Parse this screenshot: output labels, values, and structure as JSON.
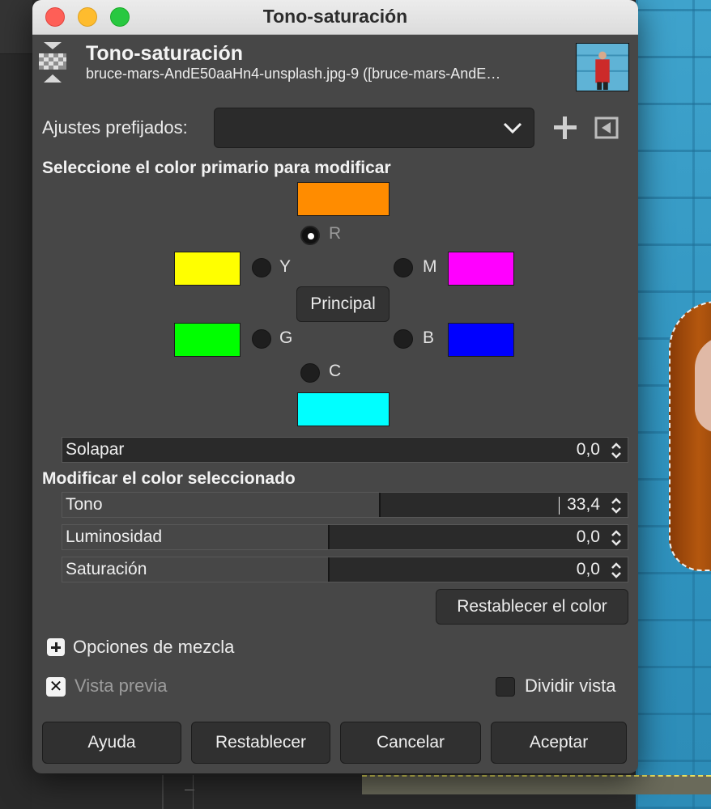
{
  "window": {
    "title": "Tono-saturación"
  },
  "header": {
    "title": "Tono-saturación",
    "subtitle": "bruce-mars-AndE50aaHn4-unsplash.jpg-9 ([bruce-mars-AndE…",
    "tool_icon": "hue-saturation-tool-icon",
    "thumbnail": "image-thumbnail"
  },
  "presets": {
    "label": "Ajustes prefijados:",
    "value": "",
    "add_icon": "plus-icon",
    "menu_icon": "triangle-left-menu-icon"
  },
  "primary": {
    "title": "Seleccione el color primario para modificar",
    "colors": {
      "r": {
        "label": "R",
        "swatch": "#ff8c00",
        "selected": true
      },
      "y": {
        "label": "Y",
        "swatch": "#ffff00",
        "selected": false
      },
      "m": {
        "label": "M",
        "swatch": "#ff00ff",
        "selected": false
      },
      "g": {
        "label": "G",
        "swatch": "#00ff00",
        "selected": false
      },
      "b": {
        "label": "B",
        "swatch": "#0000ff",
        "selected": false
      },
      "c": {
        "label": "C",
        "swatch": "#00ffff",
        "selected": false
      }
    },
    "master_button": "Principal",
    "overlap": {
      "label": "Solapar",
      "value": "0,0",
      "fraction": 0.0
    }
  },
  "modify": {
    "title": "Modificar el color seleccionado",
    "hue": {
      "label": "Tono",
      "value": "33,4",
      "fraction": 0.56
    },
    "lightness": {
      "label": "Luminosidad",
      "value": "0,0",
      "fraction": 0.47
    },
    "saturation": {
      "label": "Saturación",
      "value": "0,0",
      "fraction": 0.47
    },
    "reset_color_button": "Restablecer el color"
  },
  "blending": {
    "label": "Opciones de mezcla",
    "icon": "plus-expander-icon"
  },
  "preview": {
    "label": "Vista previa",
    "checked": true
  },
  "split_view": {
    "label": "Dividir vista",
    "checked": false
  },
  "buttons": {
    "help": "Ayuda",
    "reset": "Restablecer",
    "cancel": "Cancelar",
    "ok": "Aceptar"
  }
}
